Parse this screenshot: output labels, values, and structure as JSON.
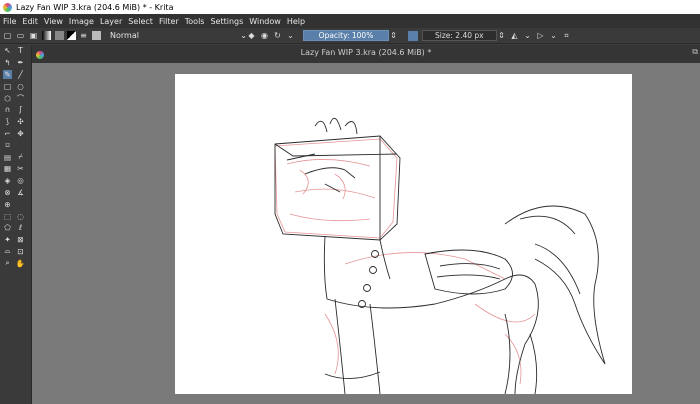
{
  "window": {
    "title": "Lazy Fan WIP 3.kra (204.6 MiB) * - Krita"
  },
  "menu": [
    "File",
    "Edit",
    "View",
    "Image",
    "Layer",
    "Select",
    "Filter",
    "Tools",
    "Settings",
    "Window",
    "Help"
  ],
  "toolbar": {
    "blend_mode": "Normal",
    "opacity": "Opacity: 100%",
    "size": "Size: 2.40 px"
  },
  "document": {
    "tab_title": "Lazy Fan WIP 3.kra (204.6 MiB) *"
  },
  "colors": {
    "accent": "#5a7fa8",
    "canvas": "#ffffff",
    "workspace": "#7a7a7a"
  }
}
